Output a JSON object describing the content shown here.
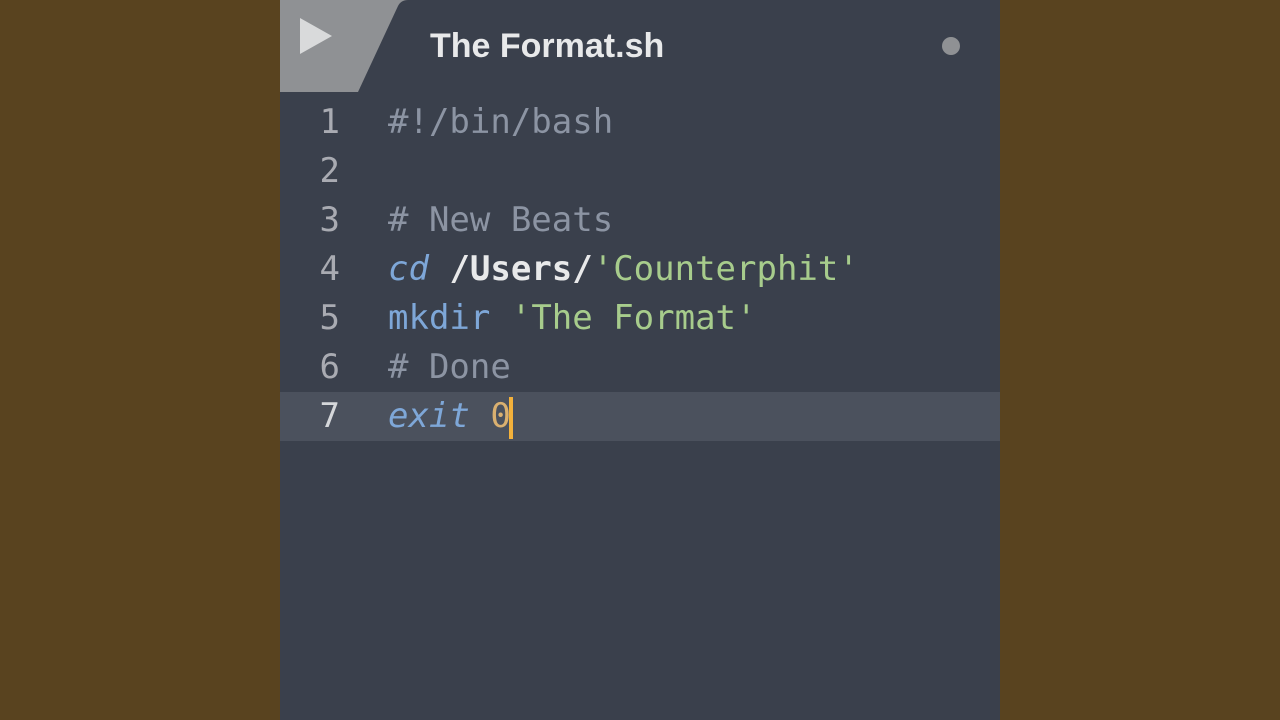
{
  "tab": {
    "filename": "The Format.sh",
    "dirty": true
  },
  "colors": {
    "background": "#3a404c",
    "tabbar": "#8f9194",
    "gutter_text": "#a9abb2",
    "active_line": "#4b515d",
    "text": "#d5d7da",
    "comment": "#8c94a3",
    "builtin": "#7ea7d8",
    "string": "#a7cc8c",
    "number": "#dab070",
    "cursor": "#f3b13b",
    "page_bg": "#59431f"
  },
  "line_numbers": [
    "1",
    "2",
    "3",
    "4",
    "5",
    "6",
    "7"
  ],
  "active_line_index": 6,
  "code_lines": [
    {
      "tokens": [
        {
          "t": "#!/bin/bash",
          "c": "comment"
        }
      ]
    },
    {
      "tokens": [
        {
          "t": "",
          "c": "plain"
        }
      ]
    },
    {
      "tokens": [
        {
          "t": "# New Beats",
          "c": "comment"
        }
      ]
    },
    {
      "tokens": [
        {
          "t": "cd",
          "c": "builtin"
        },
        {
          "t": " ",
          "c": "plain"
        },
        {
          "t": "/Users/",
          "c": "path"
        },
        {
          "t": "'Counterphit'",
          "c": "string"
        }
      ]
    },
    {
      "tokens": [
        {
          "t": "mkdir",
          "c": "keyword"
        },
        {
          "t": " ",
          "c": "plain"
        },
        {
          "t": "'The Format'",
          "c": "string"
        }
      ]
    },
    {
      "tokens": [
        {
          "t": "# Done",
          "c": "comment"
        }
      ]
    },
    {
      "tokens": [
        {
          "t": "exit",
          "c": "builtin"
        },
        {
          "t": " ",
          "c": "plain"
        },
        {
          "t": "0",
          "c": "number"
        }
      ],
      "cursor_after": true
    }
  ]
}
